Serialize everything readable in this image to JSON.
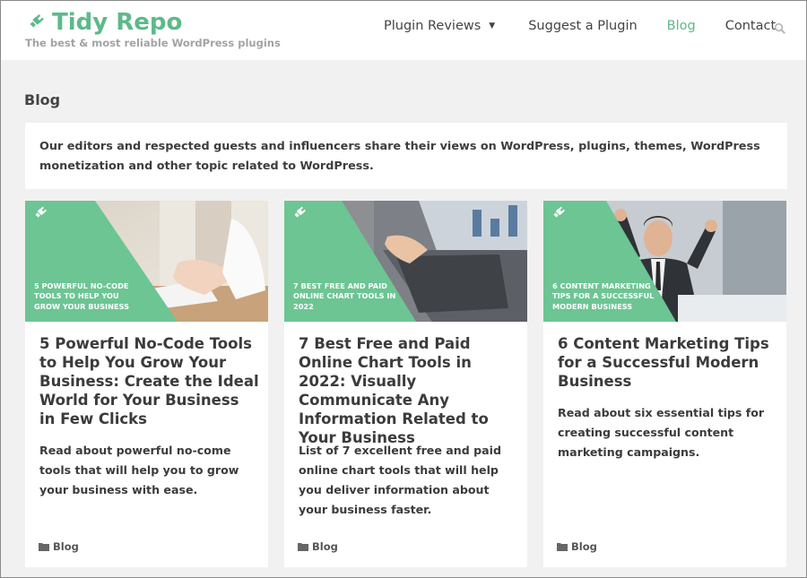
{
  "brand": {
    "title": "Tidy Repo",
    "tagline": "The best & most reliable WordPress plugins"
  },
  "nav": {
    "items": [
      "Plugin Reviews",
      "Suggest a Plugin",
      "Blog",
      "Contact"
    ],
    "active": "Blog"
  },
  "page": {
    "title": "Blog",
    "intro": "Our editors and respected guests and influencers share their views on WordPress, plugins, themes, WordPress monetization and other topic related to WordPress."
  },
  "colors": {
    "brand_green": "#5cba8a",
    "overlay_green": "#6cc593"
  },
  "posts": [
    {
      "image_caption": "5 Powerful No-Code Tools to Help You Grow Your Business",
      "title": "5 Powerful No-Code Tools to Help You Grow Your Business: Create the Ideal World for Your Business in Few Clicks",
      "excerpt": "Read about powerful no-come tools that will help you to grow your business with ease.",
      "category": "Blog"
    },
    {
      "image_caption": "7 Best Free and Paid Online Chart Tools in 2022",
      "title": "7 Best Free and Paid Online Chart Tools in 2022: Visually Communicate Any Information Related to Your Business",
      "excerpt": "List of 7 excellent free and paid online chart tools that will help you deliver information about your business faster.",
      "category": "Blog"
    },
    {
      "image_caption": "6 Content Marketing Tips for a Successful Modern Business",
      "title": "6 Content Marketing Tips for a Successful Modern Business",
      "excerpt": "Read about six essential tips for creating successful content marketing campaigns.",
      "category": "Blog"
    }
  ]
}
